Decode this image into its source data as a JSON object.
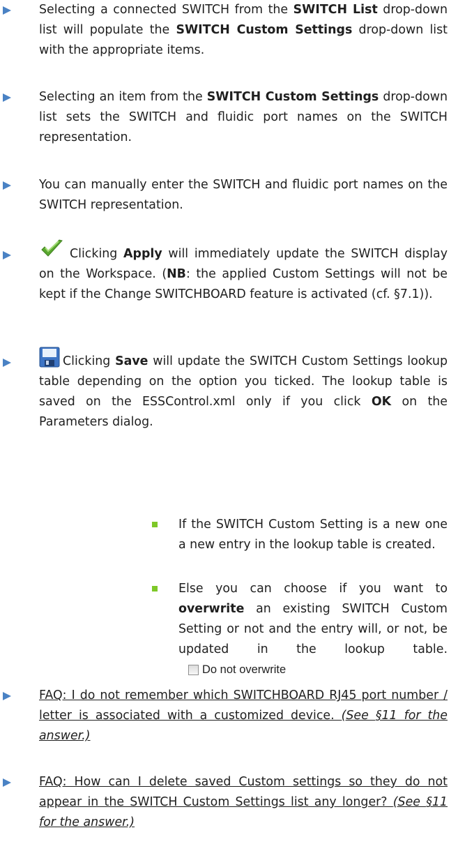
{
  "items": [
    {
      "parts": [
        "Selecting a connected SWITCH from the ",
        "SWITCH List",
        " drop-down list will populate the ",
        "SWITCH Custom Settings",
        " drop-down list with the appropriate items."
      ]
    },
    {
      "parts": [
        "Selecting an item from the ",
        "SWITCH Custom Settings",
        " drop-down list sets the SWITCH and fluidic port names on the SWITCH representation."
      ]
    },
    {
      "parts": [
        "You can manually enter the SWITCH and fluidic port names on the SWITCH representation."
      ]
    },
    {
      "icon": "green-checkmark-icon",
      "parts": [
        "Clicking ",
        "Apply",
        " will immediately update the SWITCH display on the Workspace. (",
        "NB",
        ": the applied Custom Settings will not be kept if the Change SWITCHBOARD feature is activated (cf. §7.1))."
      ]
    },
    {
      "icon": "save-disk-icon",
      "parts": [
        "Clicking ",
        "Save",
        " will update the SWITCH Custom Settings lookup table depending on the option you ticked. The lookup table is saved on the ESSControl.xml only if you click ",
        "OK",
        " on the Parameters dialog."
      ]
    }
  ],
  "sub_items": [
    {
      "parts": [
        "If the SWITCH Custom Setting is a new one a new entry in the lookup table is created."
      ]
    },
    {
      "parts": [
        "Else you can choose if you want to ",
        "overwrite",
        " an existing SWITCH Custom Setting or not and the entry will, or not, be updated in the lookup table."
      ],
      "checkbox_label": "Do not overwrite",
      "checkbox_checked": false
    }
  ],
  "faqs": [
    {
      "question": "FAQ: I do not remember which SWITCHBOARD RJ45 port number / letter is associated with a customized device. ",
      "answer": "(See §11 for the answer.)"
    },
    {
      "question": "FAQ: How can I delete saved Custom settings so they do not appear in the SWITCH Custom Settings list any longer? ",
      "answer": "(See §11 for the answer.)"
    }
  ],
  "colors": {
    "bullet_arrow": "#4a82c4",
    "sub_bullet_square": "#7ec828",
    "text": "#1f1f1f"
  }
}
